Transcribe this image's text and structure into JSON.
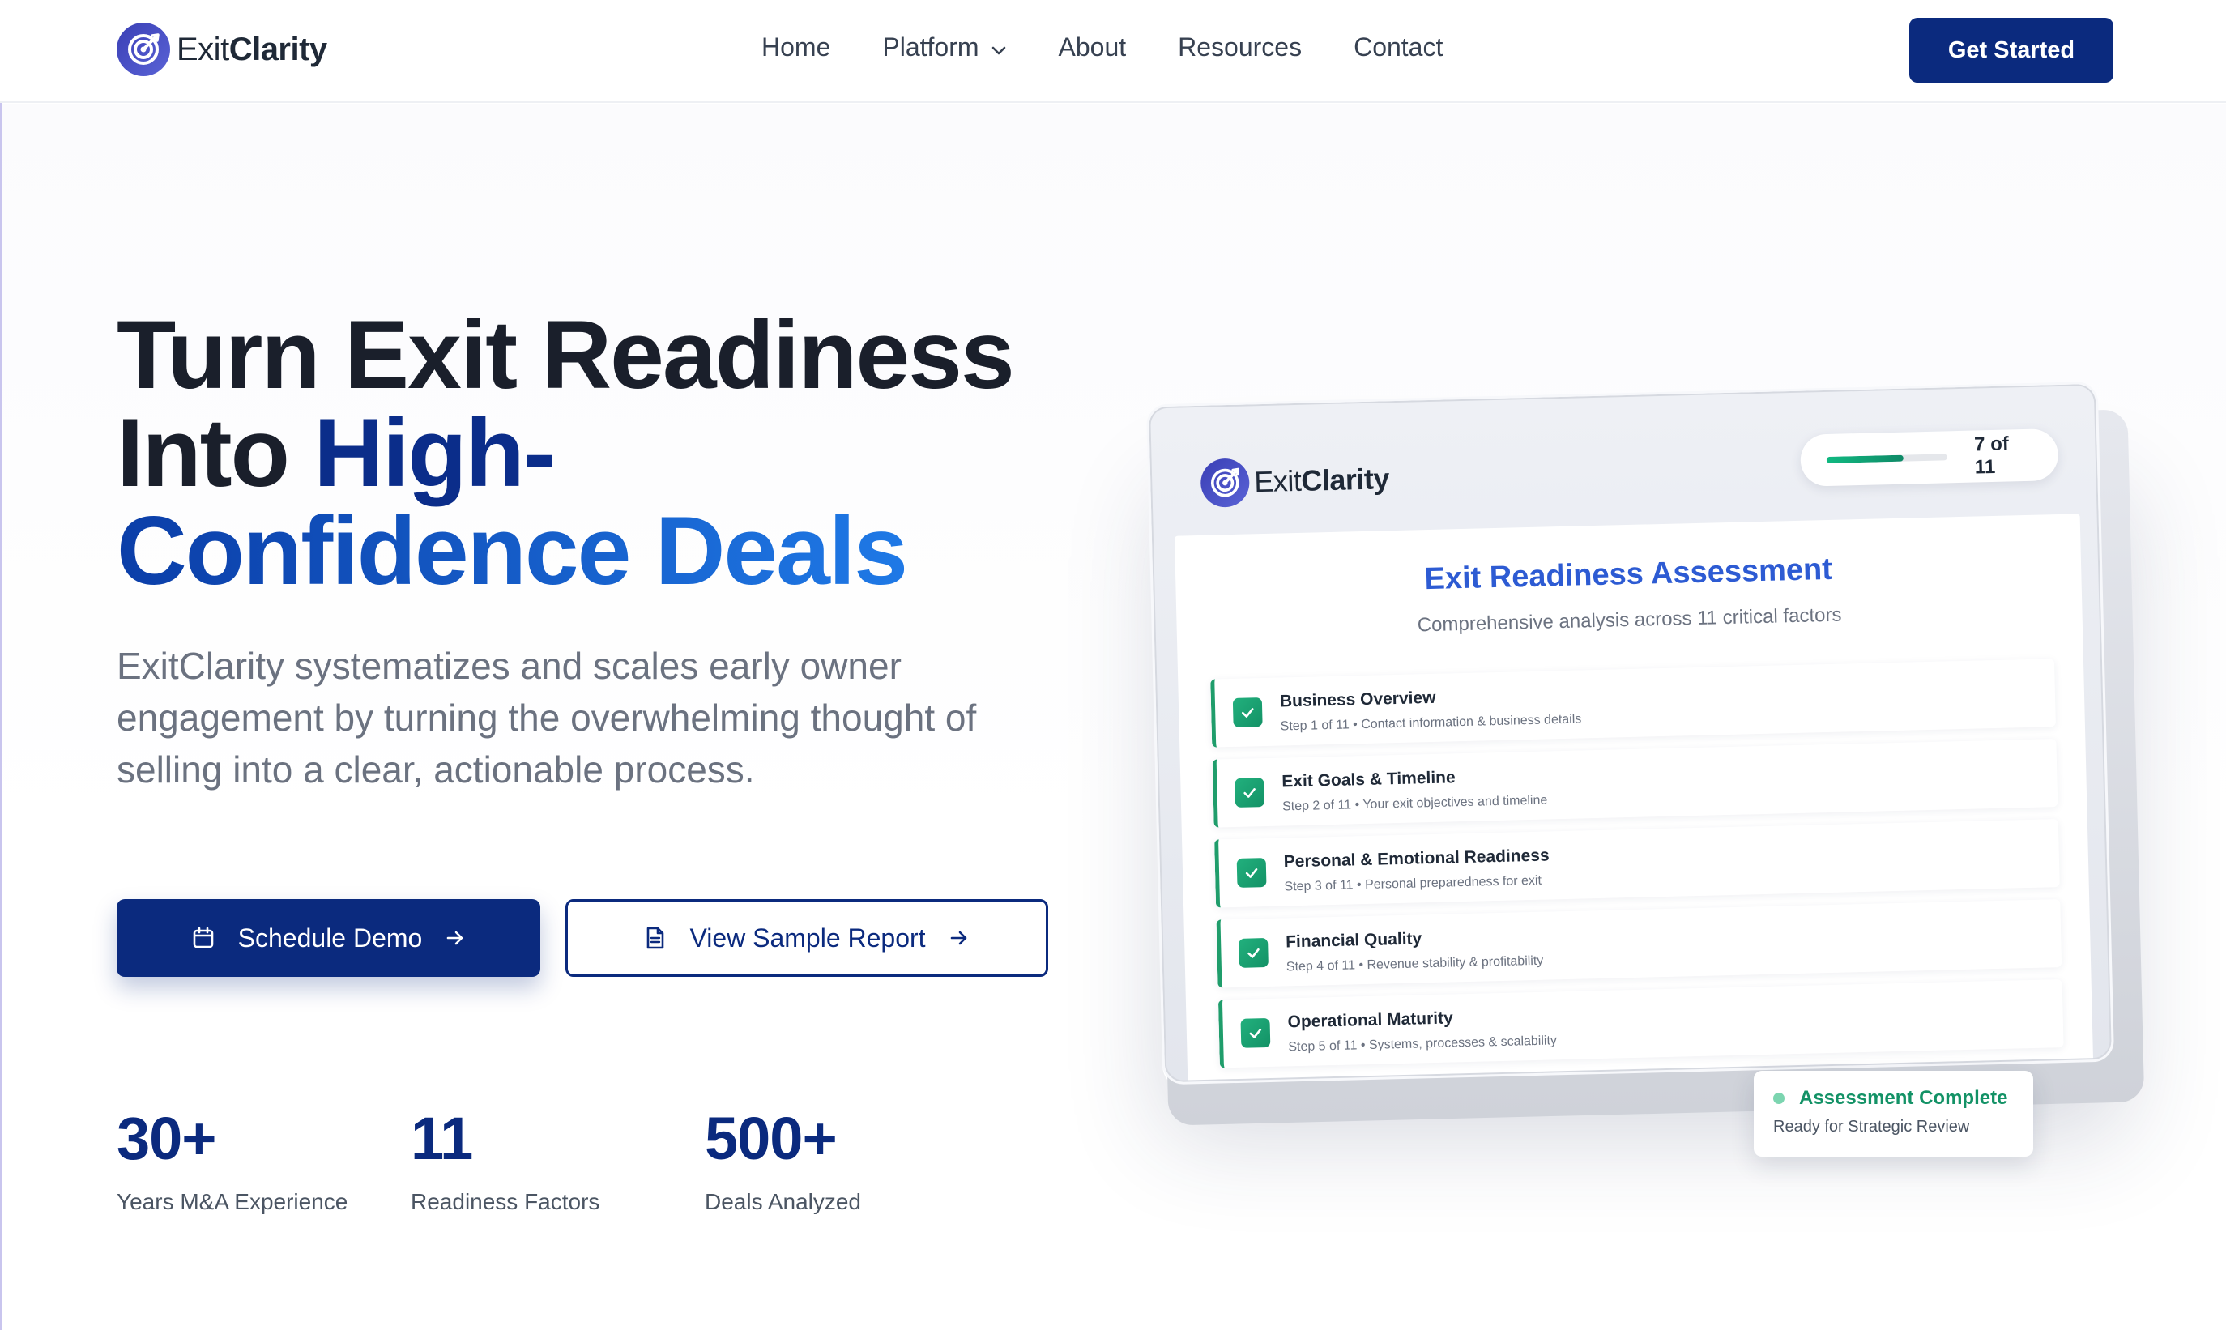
{
  "colors": {
    "brand_navy": "#0b2a7e",
    "accent_blue": "#1f79e6",
    "success_green": "#139266"
  },
  "nav": {
    "brand_prefix": "Exit",
    "brand_suffix": "Clarity",
    "links": [
      "Home",
      "Platform",
      "About",
      "Resources",
      "Contact"
    ],
    "cta_label": "Get Started"
  },
  "hero": {
    "headline_line1": "Turn Exit Readiness",
    "headline_line2_plain": "Into ",
    "headline_line2_accent": "High-",
    "headline_line3": "Confidence Deals",
    "subhead": "ExitClarity systematizes and scales early owner engagement by turning the overwhelming thought of selling into a clear, actionable process.",
    "primary_cta": "Schedule Demo",
    "secondary_cta": "View Sample Report"
  },
  "stats": [
    {
      "value": "30+",
      "label": "Years M&A Experience"
    },
    {
      "value": "11",
      "label": "Readiness Factors"
    },
    {
      "value": "500+",
      "label": "Deals Analyzed"
    }
  ],
  "mockup": {
    "brand_prefix": "Exit",
    "brand_suffix": "Clarity",
    "progress_text": "7 of 11",
    "progress_fraction": 0.64,
    "title": "Exit Readiness Assessment",
    "subtitle": "Comprehensive analysis across 11 critical factors",
    "steps": [
      {
        "title": "Business Overview",
        "detail": "Step 1 of 11 • Contact information & business details"
      },
      {
        "title": "Exit Goals & Timeline",
        "detail": "Step 2 of 11 • Your exit objectives and timeline"
      },
      {
        "title": "Personal & Emotional Readiness",
        "detail": "Step 3 of 11 • Personal preparedness for exit"
      },
      {
        "title": "Financial Quality",
        "detail": "Step 4 of 11 • Revenue stability & profitability"
      },
      {
        "title": "Operational Maturity",
        "detail": "Step 5 of 11 • Systems, processes & scalability"
      }
    ],
    "badge_title": "Assessment Complete",
    "badge_subtitle": "Ready for Strategic Review"
  }
}
